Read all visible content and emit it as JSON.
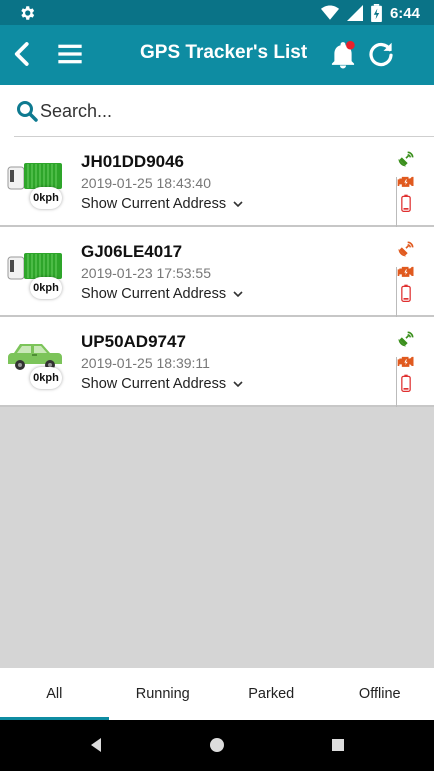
{
  "status_bar": {
    "time": "6:44",
    "icons": [
      "settings-gear-icon",
      "wifi-icon",
      "cell-signal-icon",
      "battery-charging-icon"
    ]
  },
  "app_bar": {
    "title": "GPS Tracker's List",
    "icons": [
      "back-arrow-icon",
      "menu-icon",
      "notification-bell-icon",
      "refresh-icon"
    ],
    "color": "#0e8ca2"
  },
  "search": {
    "placeholder": "Search..."
  },
  "trackers": [
    {
      "plate": "JH01DD9046",
      "timestamp": "2019-01-25 18:43:40",
      "address_label": "Show Current Address",
      "speed": "0kph",
      "vehicle_type": "truck",
      "gps_status": "green",
      "ignition_status": "orange",
      "battery_status": "red"
    },
    {
      "plate": "GJ06LE4017",
      "timestamp": "2019-01-23 17:53:55",
      "address_label": "Show Current Address",
      "speed": "0kph",
      "vehicle_type": "truck",
      "gps_status": "orange",
      "ignition_status": "orange",
      "battery_status": "red"
    },
    {
      "plate": "UP50AD9747",
      "timestamp": "2019-01-25 18:39:11",
      "address_label": "Show Current Address",
      "speed": "0kph",
      "vehicle_type": "car",
      "gps_status": "green",
      "ignition_status": "orange",
      "battery_status": "red"
    }
  ],
  "tabs": [
    {
      "label": "All",
      "active": true
    },
    {
      "label": "Running",
      "active": false
    },
    {
      "label": "Parked",
      "active": false
    },
    {
      "label": "Offline",
      "active": false
    }
  ],
  "colors": {
    "status_bar": "#0a7387",
    "accent": "#0e8ca2",
    "gps_green": "#3a8f1c",
    "alert_orange": "#e05a1f",
    "battery_red": "#e03030",
    "vehicle_green": "#2fa32a"
  }
}
